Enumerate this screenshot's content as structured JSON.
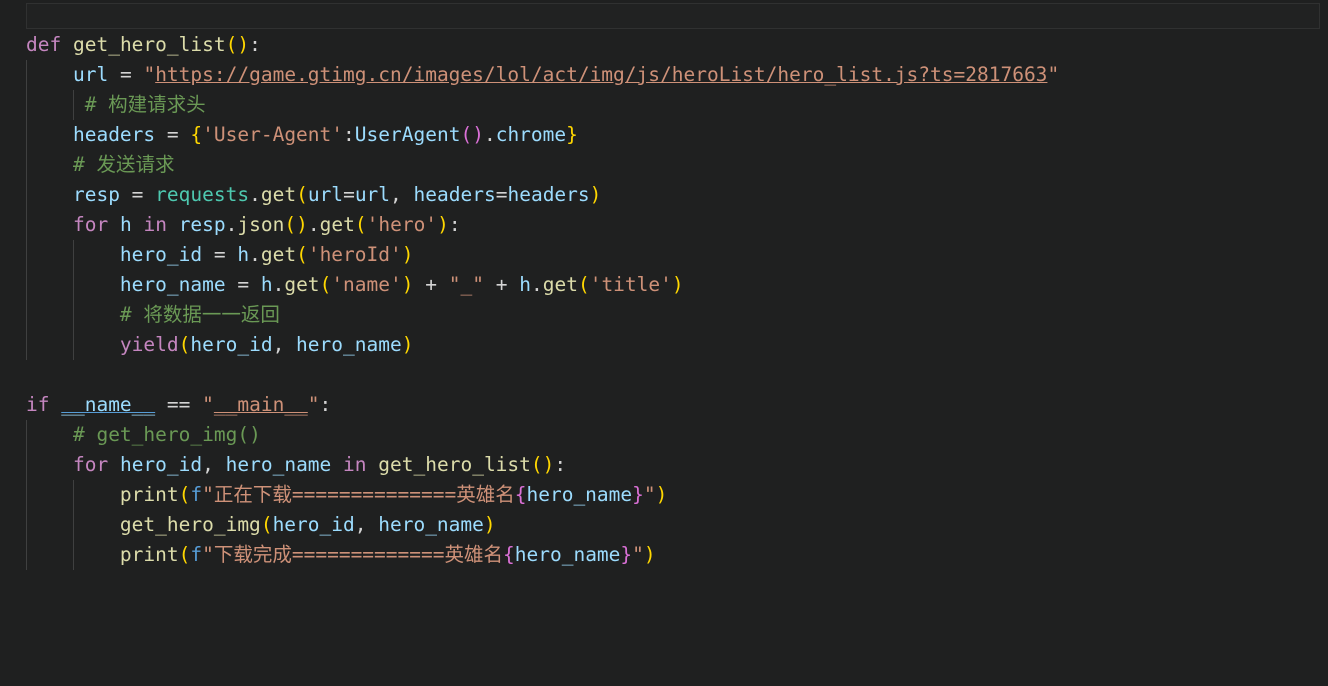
{
  "editor": {
    "language": "python",
    "theme": "dark-plus",
    "background": "#1f2020",
    "font_size_px": 19.5,
    "line_height_px": 30,
    "colors": {
      "keyword": "#c586c0",
      "function": "#dcdcaa",
      "variable": "#9cdcfe",
      "string": "#ce9178",
      "operator": "#d4d4d4",
      "comment": "#6a9955",
      "bracket_level_0": "#ffd700",
      "bracket_level_1": "#da70d6",
      "bracket_level_2": "#179fff",
      "module": "#4ec9b0",
      "indent_guide": "#3f4040",
      "selection_outline": "#303131"
    }
  },
  "source_text": "def get_hero_list():\n    url = \"https://game.gtimg.cn/images/lol/act/img/js/heroList/hero_list.js?ts=2817663\"\n     # 构建请求头\n    headers = {'User-Agent':UserAgent().chrome}\n    # 发送请求\n    resp = requests.get(url=url, headers=headers)\n    for h in resp.json().get('hero'):\n        hero_id = h.get('heroId')\n        hero_name = h.get('name') + \"_\" + h.get('title')\n        # 将数据一一返回\n        yield(hero_id, hero_name)\n\nif __name__ == \"__main__\":\n    # get_hero_img()\n    for hero_id, hero_name in get_hero_list():\n        print(f\"正在下载==============英雄名{hero_name}\")\n        get_hero_img(hero_id, hero_name)\n        print(f\"下载完成=============英雄名{hero_name}\")",
  "lines": [
    {
      "n": 1,
      "indent": 0,
      "guides": [],
      "tokens": [
        {
          "t": "def",
          "c": "kw"
        },
        {
          "t": " ",
          "c": "plain"
        },
        {
          "t": "get_hero_list",
          "c": "fn"
        },
        {
          "t": "(",
          "c": "paren0"
        },
        {
          "t": ")",
          "c": "paren0"
        },
        {
          "t": ":",
          "c": "op"
        }
      ]
    },
    {
      "n": 2,
      "indent": 4,
      "guides": [
        0
      ],
      "tokens": [
        {
          "t": "    ",
          "c": "plain"
        },
        {
          "t": "url",
          "c": "var"
        },
        {
          "t": " = ",
          "c": "op"
        },
        {
          "t": "\"",
          "c": "str"
        },
        {
          "t": "https://game.gtimg.cn/images/lol/act/img/js/heroList/hero_list.js?ts=2817663",
          "c": "link"
        },
        {
          "t": "\"",
          "c": "str"
        }
      ]
    },
    {
      "n": 3,
      "indent": 5,
      "guides": [
        0,
        1
      ],
      "tokens": [
        {
          "t": "     ",
          "c": "plain"
        },
        {
          "t": "# 构建请求头",
          "c": "comment"
        }
      ]
    },
    {
      "n": 4,
      "indent": 4,
      "guides": [
        0
      ],
      "tokens": [
        {
          "t": "    ",
          "c": "plain"
        },
        {
          "t": "headers",
          "c": "var"
        },
        {
          "t": " = ",
          "c": "op"
        },
        {
          "t": "{",
          "c": "paren0"
        },
        {
          "t": "'User-Agent'",
          "c": "str"
        },
        {
          "t": ":",
          "c": "op"
        },
        {
          "t": "UserAgent",
          "c": "var"
        },
        {
          "t": "(",
          "c": "paren1"
        },
        {
          "t": ")",
          "c": "paren1"
        },
        {
          "t": ".",
          "c": "op"
        },
        {
          "t": "chrome",
          "c": "var"
        },
        {
          "t": "}",
          "c": "paren0"
        }
      ]
    },
    {
      "n": 5,
      "indent": 4,
      "guides": [
        0
      ],
      "tokens": [
        {
          "t": "    ",
          "c": "plain"
        },
        {
          "t": "# 发送请求",
          "c": "comment"
        }
      ]
    },
    {
      "n": 6,
      "indent": 4,
      "guides": [
        0
      ],
      "tokens": [
        {
          "t": "    ",
          "c": "plain"
        },
        {
          "t": "resp",
          "c": "var"
        },
        {
          "t": " = ",
          "c": "op"
        },
        {
          "t": "requests",
          "c": "mod"
        },
        {
          "t": ".",
          "c": "op"
        },
        {
          "t": "get",
          "c": "fn"
        },
        {
          "t": "(",
          "c": "paren0"
        },
        {
          "t": "url",
          "c": "var"
        },
        {
          "t": "=",
          "c": "op"
        },
        {
          "t": "url",
          "c": "var"
        },
        {
          "t": ", ",
          "c": "op"
        },
        {
          "t": "headers",
          "c": "var"
        },
        {
          "t": "=",
          "c": "op"
        },
        {
          "t": "headers",
          "c": "var"
        },
        {
          "t": ")",
          "c": "paren0"
        }
      ]
    },
    {
      "n": 7,
      "indent": 4,
      "guides": [
        0
      ],
      "tokens": [
        {
          "t": "    ",
          "c": "plain"
        },
        {
          "t": "for",
          "c": "kw"
        },
        {
          "t": " ",
          "c": "plain"
        },
        {
          "t": "h",
          "c": "var"
        },
        {
          "t": " ",
          "c": "plain"
        },
        {
          "t": "in",
          "c": "kw"
        },
        {
          "t": " ",
          "c": "plain"
        },
        {
          "t": "resp",
          "c": "var"
        },
        {
          "t": ".",
          "c": "op"
        },
        {
          "t": "json",
          "c": "fn"
        },
        {
          "t": "(",
          "c": "paren0"
        },
        {
          "t": ")",
          "c": "paren0"
        },
        {
          "t": ".",
          "c": "op"
        },
        {
          "t": "get",
          "c": "fn"
        },
        {
          "t": "(",
          "c": "paren0"
        },
        {
          "t": "'hero'",
          "c": "str"
        },
        {
          "t": ")",
          "c": "paren0"
        },
        {
          "t": ":",
          "c": "op"
        }
      ]
    },
    {
      "n": 8,
      "indent": 8,
      "guides": [
        0,
        1
      ],
      "tokens": [
        {
          "t": "        ",
          "c": "plain"
        },
        {
          "t": "hero_id",
          "c": "var"
        },
        {
          "t": " = ",
          "c": "op"
        },
        {
          "t": "h",
          "c": "var"
        },
        {
          "t": ".",
          "c": "op"
        },
        {
          "t": "get",
          "c": "fn"
        },
        {
          "t": "(",
          "c": "paren0"
        },
        {
          "t": "'heroId'",
          "c": "str"
        },
        {
          "t": ")",
          "c": "paren0"
        }
      ]
    },
    {
      "n": 9,
      "indent": 8,
      "guides": [
        0,
        1
      ],
      "tokens": [
        {
          "t": "        ",
          "c": "plain"
        },
        {
          "t": "hero_name",
          "c": "var"
        },
        {
          "t": " = ",
          "c": "op"
        },
        {
          "t": "h",
          "c": "var"
        },
        {
          "t": ".",
          "c": "op"
        },
        {
          "t": "get",
          "c": "fn"
        },
        {
          "t": "(",
          "c": "paren0"
        },
        {
          "t": "'name'",
          "c": "str"
        },
        {
          "t": ")",
          "c": "paren0"
        },
        {
          "t": " + ",
          "c": "op"
        },
        {
          "t": "\"_\"",
          "c": "str"
        },
        {
          "t": " + ",
          "c": "op"
        },
        {
          "t": "h",
          "c": "var"
        },
        {
          "t": ".",
          "c": "op"
        },
        {
          "t": "get",
          "c": "fn"
        },
        {
          "t": "(",
          "c": "paren0"
        },
        {
          "t": "'title'",
          "c": "str"
        },
        {
          "t": ")",
          "c": "paren0"
        }
      ]
    },
    {
      "n": 10,
      "indent": 8,
      "guides": [
        0,
        1
      ],
      "tokens": [
        {
          "t": "        ",
          "c": "plain"
        },
        {
          "t": "# 将数据一一返回",
          "c": "comment"
        }
      ]
    },
    {
      "n": 11,
      "indent": 8,
      "guides": [
        0,
        1
      ],
      "tokens": [
        {
          "t": "        ",
          "c": "plain"
        },
        {
          "t": "yield",
          "c": "kw"
        },
        {
          "t": "(",
          "c": "paren0"
        },
        {
          "t": "hero_id",
          "c": "var"
        },
        {
          "t": ", ",
          "c": "op"
        },
        {
          "t": "hero_name",
          "c": "var"
        },
        {
          "t": ")",
          "c": "paren0"
        }
      ]
    },
    {
      "n": 12,
      "indent": 0,
      "guides": [],
      "tokens": []
    },
    {
      "n": 13,
      "indent": 0,
      "guides": [],
      "tokens": [
        {
          "t": "if",
          "c": "kw"
        },
        {
          "t": " ",
          "c": "plain"
        },
        {
          "t": "__name__",
          "c": "dunder"
        },
        {
          "t": " == ",
          "c": "op"
        },
        {
          "t": "\"",
          "c": "str"
        },
        {
          "t": "__main__",
          "c": "dunderstr"
        },
        {
          "t": "\"",
          "c": "str"
        },
        {
          "t": ":",
          "c": "op"
        }
      ]
    },
    {
      "n": 14,
      "indent": 4,
      "guides": [
        0
      ],
      "tokens": [
        {
          "t": "    ",
          "c": "plain"
        },
        {
          "t": "# get_hero_img()",
          "c": "comment"
        }
      ]
    },
    {
      "n": 15,
      "indent": 4,
      "guides": [
        0
      ],
      "tokens": [
        {
          "t": "    ",
          "c": "plain"
        },
        {
          "t": "for",
          "c": "kw"
        },
        {
          "t": " ",
          "c": "plain"
        },
        {
          "t": "hero_id",
          "c": "var"
        },
        {
          "t": ", ",
          "c": "op"
        },
        {
          "t": "hero_name",
          "c": "var"
        },
        {
          "t": " ",
          "c": "plain"
        },
        {
          "t": "in",
          "c": "kw"
        },
        {
          "t": " ",
          "c": "plain"
        },
        {
          "t": "get_hero_list",
          "c": "fn"
        },
        {
          "t": "(",
          "c": "paren0"
        },
        {
          "t": ")",
          "c": "paren0"
        },
        {
          "t": ":",
          "c": "op"
        }
      ]
    },
    {
      "n": 16,
      "indent": 8,
      "guides": [
        0,
        1
      ],
      "tokens": [
        {
          "t": "        ",
          "c": "plain"
        },
        {
          "t": "print",
          "c": "fn"
        },
        {
          "t": "(",
          "c": "paren0"
        },
        {
          "t": "f",
          "c": "fprefix"
        },
        {
          "t": "\"正在下载==============英雄名",
          "c": "str"
        },
        {
          "t": "{",
          "c": "brace"
        },
        {
          "t": "hero_name",
          "c": "var"
        },
        {
          "t": "}",
          "c": "brace"
        },
        {
          "t": "\"",
          "c": "str"
        },
        {
          "t": ")",
          "c": "paren0"
        }
      ]
    },
    {
      "n": 17,
      "indent": 8,
      "guides": [
        0,
        1
      ],
      "tokens": [
        {
          "t": "        ",
          "c": "plain"
        },
        {
          "t": "get_hero_img",
          "c": "fn"
        },
        {
          "t": "(",
          "c": "paren0"
        },
        {
          "t": "hero_id",
          "c": "var"
        },
        {
          "t": ", ",
          "c": "op"
        },
        {
          "t": "hero_name",
          "c": "var"
        },
        {
          "t": ")",
          "c": "paren0"
        }
      ]
    },
    {
      "n": 18,
      "indent": 8,
      "guides": [
        0,
        1
      ],
      "tokens": [
        {
          "t": "        ",
          "c": "plain"
        },
        {
          "t": "print",
          "c": "fn"
        },
        {
          "t": "(",
          "c": "paren0"
        },
        {
          "t": "f",
          "c": "fprefix"
        },
        {
          "t": "\"下载完成=============英雄名",
          "c": "str"
        },
        {
          "t": "{",
          "c": "brace"
        },
        {
          "t": "hero_name",
          "c": "var"
        },
        {
          "t": "}",
          "c": "brace"
        },
        {
          "t": "\"",
          "c": "str"
        },
        {
          "t": ")",
          "c": "paren0"
        }
      ]
    }
  ]
}
